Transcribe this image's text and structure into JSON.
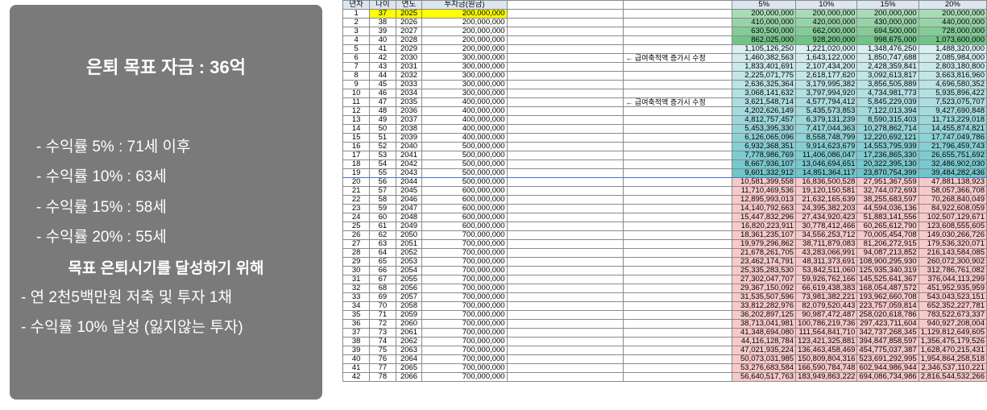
{
  "panel": {
    "title": "은퇴 목표 자금 : 36억",
    "items": [
      "- 수익률   5% : 71세 이후",
      "- 수익률 10% : 63세",
      "- 수익률 15% : 58세",
      "- 수익률 20% : 55세"
    ],
    "subtitle": "목표 은퇴시기를 달성하기 위해",
    "actions": [
      "- 연 2천5백만원 저축 및 투자 1채",
      "- 수익률 10% 달성 (잃지않는 투자)"
    ]
  },
  "sheet": {
    "headers": [
      "년차",
      "나이",
      "연도",
      "투자금(원금)",
      "5%",
      "10%",
      "15%",
      "20%"
    ],
    "notes": {
      "5": "← 급여축적액 증가시 수정",
      "10": "← 급여축적액 증가시 수정"
    },
    "colors": {
      "green": "#63be7b",
      "teal": "#68c4c9",
      "pink": "#f8c9c9",
      "yellow": "#ffff00",
      "header": "#dce6f1"
    },
    "rows": [
      [
        "1",
        "37",
        "2025",
        "200,000,000",
        "200,000,000",
        "200,000,000",
        "200,000,000",
        "200,000,000"
      ],
      [
        "2",
        "38",
        "2026",
        "200,000,000",
        "410,000,000",
        "420,000,000",
        "430,000,000",
        "440,000,000"
      ],
      [
        "3",
        "39",
        "2027",
        "200,000,000",
        "630,500,000",
        "662,000,000",
        "694,500,000",
        "728,000,000"
      ],
      [
        "4",
        "40",
        "2028",
        "200,000,000",
        "862,025,000",
        "928,200,000",
        "998,675,000",
        "1,073,600,000"
      ],
      [
        "5",
        "41",
        "2029",
        "200,000,000",
        "1,105,126,250",
        "1,221,020,000",
        "1,348,476,250",
        "1,488,320,000"
      ],
      [
        "6",
        "42",
        "2030",
        "300,000,000",
        "1,460,382,563",
        "1,643,122,000",
        "1,850,747,688",
        "2,085,984,000"
      ],
      [
        "7",
        "43",
        "2031",
        "300,000,000",
        "1,833,401,691",
        "2,107,434,200",
        "2,428,359,841",
        "2,803,180,800"
      ],
      [
        "8",
        "44",
        "2032",
        "300,000,000",
        "2,225,071,775",
        "2,618,177,620",
        "3,092,613,817",
        "3,663,816,960"
      ],
      [
        "9",
        "45",
        "2033",
        "300,000,000",
        "2,636,325,364",
        "3,179,995,382",
        "3,856,505,889",
        "4,696,580,352"
      ],
      [
        "10",
        "46",
        "2034",
        "300,000,000",
        "3,068,141,632",
        "3,797,994,920",
        "4,734,981,773",
        "5,935,896,422"
      ],
      [
        "11",
        "47",
        "2035",
        "400,000,000",
        "3,621,548,714",
        "4,577,794,412",
        "5,845,229,039",
        "7,523,075,707"
      ],
      [
        "12",
        "48",
        "2036",
        "400,000,000",
        "4,202,626,149",
        "5,435,573,853",
        "7,122,013,394",
        "9,427,690,848"
      ],
      [
        "13",
        "49",
        "2037",
        "400,000,000",
        "4,812,757,457",
        "6,379,131,239",
        "8,590,315,403",
        "11,713,229,018"
      ],
      [
        "14",
        "50",
        "2038",
        "400,000,000",
        "5,453,395,330",
        "7,417,044,363",
        "10,278,862,714",
        "14,455,874,821"
      ],
      [
        "15",
        "51",
        "2039",
        "400,000,000",
        "6,126,065,096",
        "8,558,748,799",
        "12,220,692,121",
        "17,747,049,786"
      ],
      [
        "16",
        "52",
        "2040",
        "500,000,000",
        "6,932,368,351",
        "9,914,623,679",
        "14,553,795,939",
        "21,796,459,743"
      ],
      [
        "17",
        "53",
        "2041",
        "500,000,000",
        "7,778,986,769",
        "11,406,086,047",
        "17,236,865,330",
        "26,655,751,692"
      ],
      [
        "18",
        "54",
        "2042",
        "500,000,000",
        "8,667,936,107",
        "13,046,694,651",
        "20,322,395,130",
        "32,486,902,030"
      ],
      [
        "19",
        "55",
        "2043",
        "500,000,000",
        "9,601,332,912",
        "14,851,364,117",
        "23,870,754,399",
        "39,484,282,436"
      ],
      [
        "20",
        "56",
        "2044",
        "500,000,000",
        "10,581,399,558",
        "16,836,500,528",
        "27,951,367,559",
        "47,881,138,923"
      ],
      [
        "21",
        "57",
        "2045",
        "600,000,000",
        "11,710,469,536",
        "19,120,150,581",
        "32,744,072,693",
        "58,057,366,708"
      ],
      [
        "22",
        "58",
        "2046",
        "600,000,000",
        "12,895,993,013",
        "21,632,165,639",
        "38,255,683,597",
        "70,268,840,049"
      ],
      [
        "23",
        "59",
        "2047",
        "600,000,000",
        "14,140,792,663",
        "24,395,382,203",
        "44,594,036,136",
        "84,922,608,059"
      ],
      [
        "24",
        "60",
        "2048",
        "600,000,000",
        "15,447,832,296",
        "27,434,920,423",
        "51,883,141,556",
        "102,507,129,671"
      ],
      [
        "25",
        "61",
        "2049",
        "600,000,000",
        "16,820,223,911",
        "30,778,412,466",
        "60,265,612,790",
        "123,608,555,605"
      ],
      [
        "26",
        "62",
        "2050",
        "700,000,000",
        "18,361,235,107",
        "34,556,253,712",
        "70,005,454,708",
        "149,030,266,726"
      ],
      [
        "27",
        "63",
        "2051",
        "700,000,000",
        "19,979,296,862",
        "38,711,879,083",
        "81,206,272,915",
        "179,536,320,071"
      ],
      [
        "28",
        "64",
        "2052",
        "700,000,000",
        "21,678,261,705",
        "43,283,066,991",
        "94,087,213,852",
        "216,143,584,085"
      ],
      [
        "29",
        "65",
        "2053",
        "700,000,000",
        "23,462,174,791",
        "48,311,373,691",
        "108,900,295,930",
        "260,072,300,902"
      ],
      [
        "30",
        "66",
        "2054",
        "700,000,000",
        "25,335,283,530",
        "53,842,511,060",
        "125,935,340,319",
        "312,786,761,082"
      ],
      [
        "31",
        "67",
        "2055",
        "700,000,000",
        "27,302,047,707",
        "59,926,762,166",
        "145,525,641,367",
        "376,044,113,299"
      ],
      [
        "32",
        "68",
        "2056",
        "700,000,000",
        "29,367,150,092",
        "66,619,438,383",
        "168,054,487,572",
        "451,952,935,959"
      ],
      [
        "33",
        "69",
        "2057",
        "700,000,000",
        "31,535,507,596",
        "73,981,382,221",
        "193,962,660,708",
        "543,043,523,151"
      ],
      [
        "34",
        "70",
        "2058",
        "700,000,000",
        "33,812,282,976",
        "82,079,520,443",
        "223,757,059,814",
        "652,352,227,781"
      ],
      [
        "35",
        "71",
        "2059",
        "700,000,000",
        "36,202,897,125",
        "90,987,472,487",
        "258,020,618,786",
        "783,522,673,337"
      ],
      [
        "36",
        "72",
        "2060",
        "700,000,000",
        "38,713,041,981",
        "100,786,219,736",
        "297,423,711,604",
        "940,927,208,004"
      ],
      [
        "37",
        "73",
        "2061",
        "700,000,000",
        "41,348,694,080",
        "111,564,841,710",
        "342,737,268,345",
        "1,129,812,649,605"
      ],
      [
        "38",
        "74",
        "2062",
        "700,000,000",
        "44,116,128,784",
        "123,421,325,881",
        "394,847,858,597",
        "1,356,475,179,526"
      ],
      [
        "39",
        "75",
        "2063",
        "700,000,000",
        "47,021,935,224",
        "136,463,458,469",
        "454,775,037,387",
        "1,628,470,215,431"
      ],
      [
        "40",
        "76",
        "2064",
        "700,000,000",
        "50,073,031,985",
        "150,809,804,316",
        "523,691,292,995",
        "1,954,864,258,518"
      ],
      [
        "41",
        "77",
        "2065",
        "700,000,000",
        "53,276,683,584",
        "166,590,784,748",
        "602,944,986,944",
        "2,346,537,110,221"
      ],
      [
        "42",
        "78",
        "2066",
        "700,000,000",
        "56,640,517,763",
        "183,949,863,222",
        "694,086,734,986",
        "2,816,544,532,266"
      ]
    ]
  }
}
